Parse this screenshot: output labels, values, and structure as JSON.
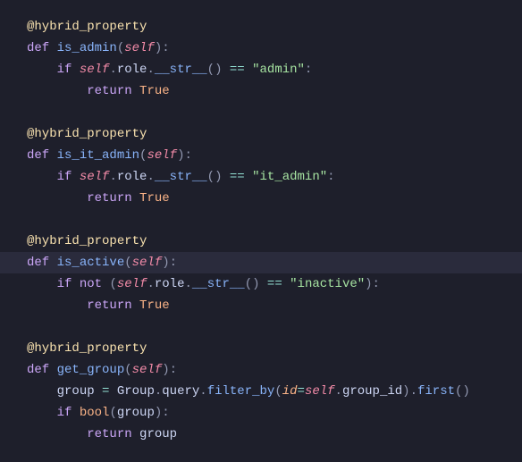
{
  "decorator": "@hybrid_property",
  "def_kw": "def",
  "if_kw": "if",
  "not_kw": "not",
  "return_kw": "return",
  "self_kw": "self",
  "true_lit": "True",
  "bool_fn": "bool",
  "fn1": {
    "name": "is_admin",
    "attr1": "role",
    "dunder": "__str__",
    "op": "==",
    "str": "\"admin\""
  },
  "fn2": {
    "name": "is_it_admin",
    "attr1": "role",
    "dunder": "__str__",
    "op": "==",
    "str": "\"it_admin\""
  },
  "fn3": {
    "name": "is_active",
    "attr1": "role",
    "dunder": "__str__",
    "op": "==",
    "str": "\"inactive\""
  },
  "fn4": {
    "name": "get_group",
    "var": "group",
    "cls": "Group",
    "query": "query",
    "filter": "filter_by",
    "kwarg": "id",
    "attr": "group_id",
    "first": "first"
  }
}
